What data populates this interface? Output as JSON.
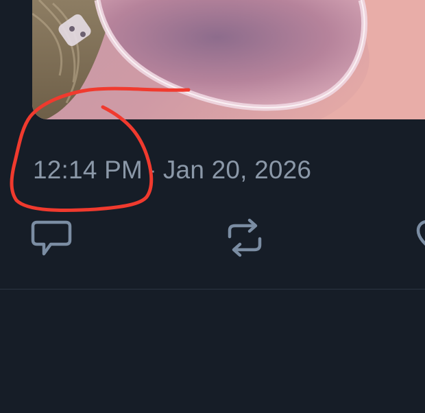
{
  "tweet": {
    "time": "12:14 PM",
    "separator": "·",
    "date": "Jan 20, 2026"
  },
  "actions": {
    "reply_icon": "reply-icon",
    "retweet_icon": "retweet-icon",
    "like_icon": "heart-icon"
  },
  "colors": {
    "background": "#161d27",
    "secondary_text": "#8b98a8",
    "icon": "#7b8da3",
    "annotation": "#f03a2e"
  }
}
